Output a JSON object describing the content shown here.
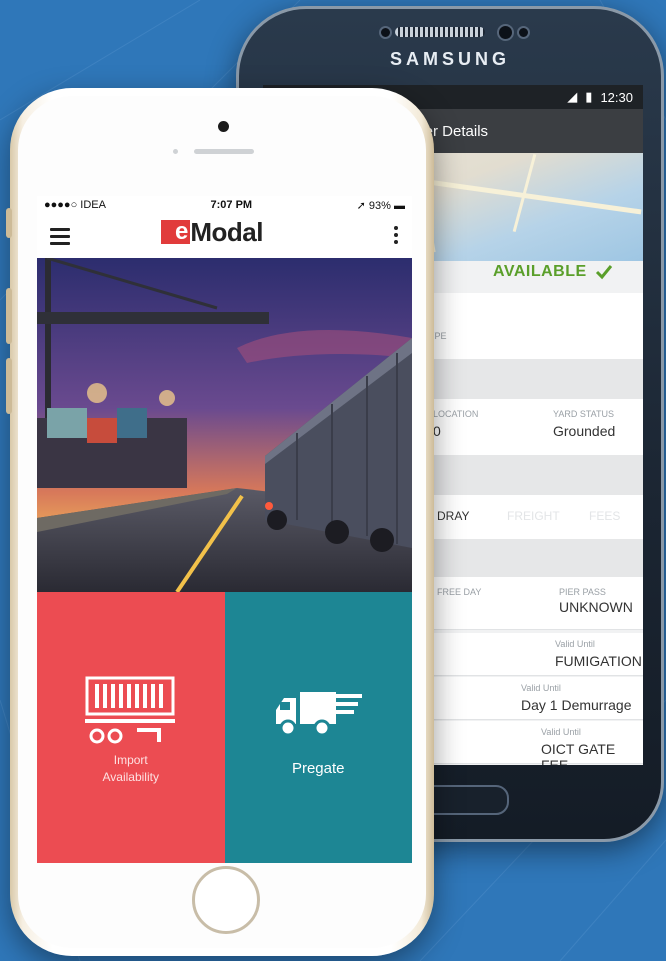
{
  "back_phone": {
    "brand": "SAMSUNG",
    "status": {
      "time": "12:30"
    },
    "app_bar_title": "iner Details",
    "availability": "AVAILABLE",
    "rows": [
      {
        "label": "TYPE",
        "value": ""
      },
      {
        "label": "LOCATION",
        "value": "0",
        "label2": "YARD STATUS",
        "value2": "Grounded"
      },
      {
        "tabs": [
          "DRAY",
          "FREIGHT",
          "FEES"
        ]
      },
      {
        "label": "FREE DAY",
        "value": "",
        "label2": "PIER PASS",
        "value2": "UNKNOWN"
      },
      {
        "label": "Valid Until",
        "value": "FUMIGATION"
      },
      {
        "label": "Valid Until",
        "value": "Day 1 Demurrage"
      },
      {
        "label": "Valid Until",
        "value": "OICT GATE FEE"
      }
    ]
  },
  "front_phone": {
    "status": {
      "carrier": "●●●●○ IDEA",
      "time": "7:07 PM",
      "battery": "93%"
    },
    "logo_e": "e",
    "logo_rest": "Modal",
    "tiles": [
      {
        "label_line1": "Import",
        "label_line2": "Availability",
        "icon": "container-icon"
      },
      {
        "label": "Pregate",
        "icon": "truck-icon"
      }
    ]
  },
  "colors": {
    "background": "#2f77b9",
    "brand_red": "#e13b3b",
    "tile_red": "#ec4c52",
    "tile_teal": "#1d8694",
    "available_green": "#5a9f2a"
  }
}
